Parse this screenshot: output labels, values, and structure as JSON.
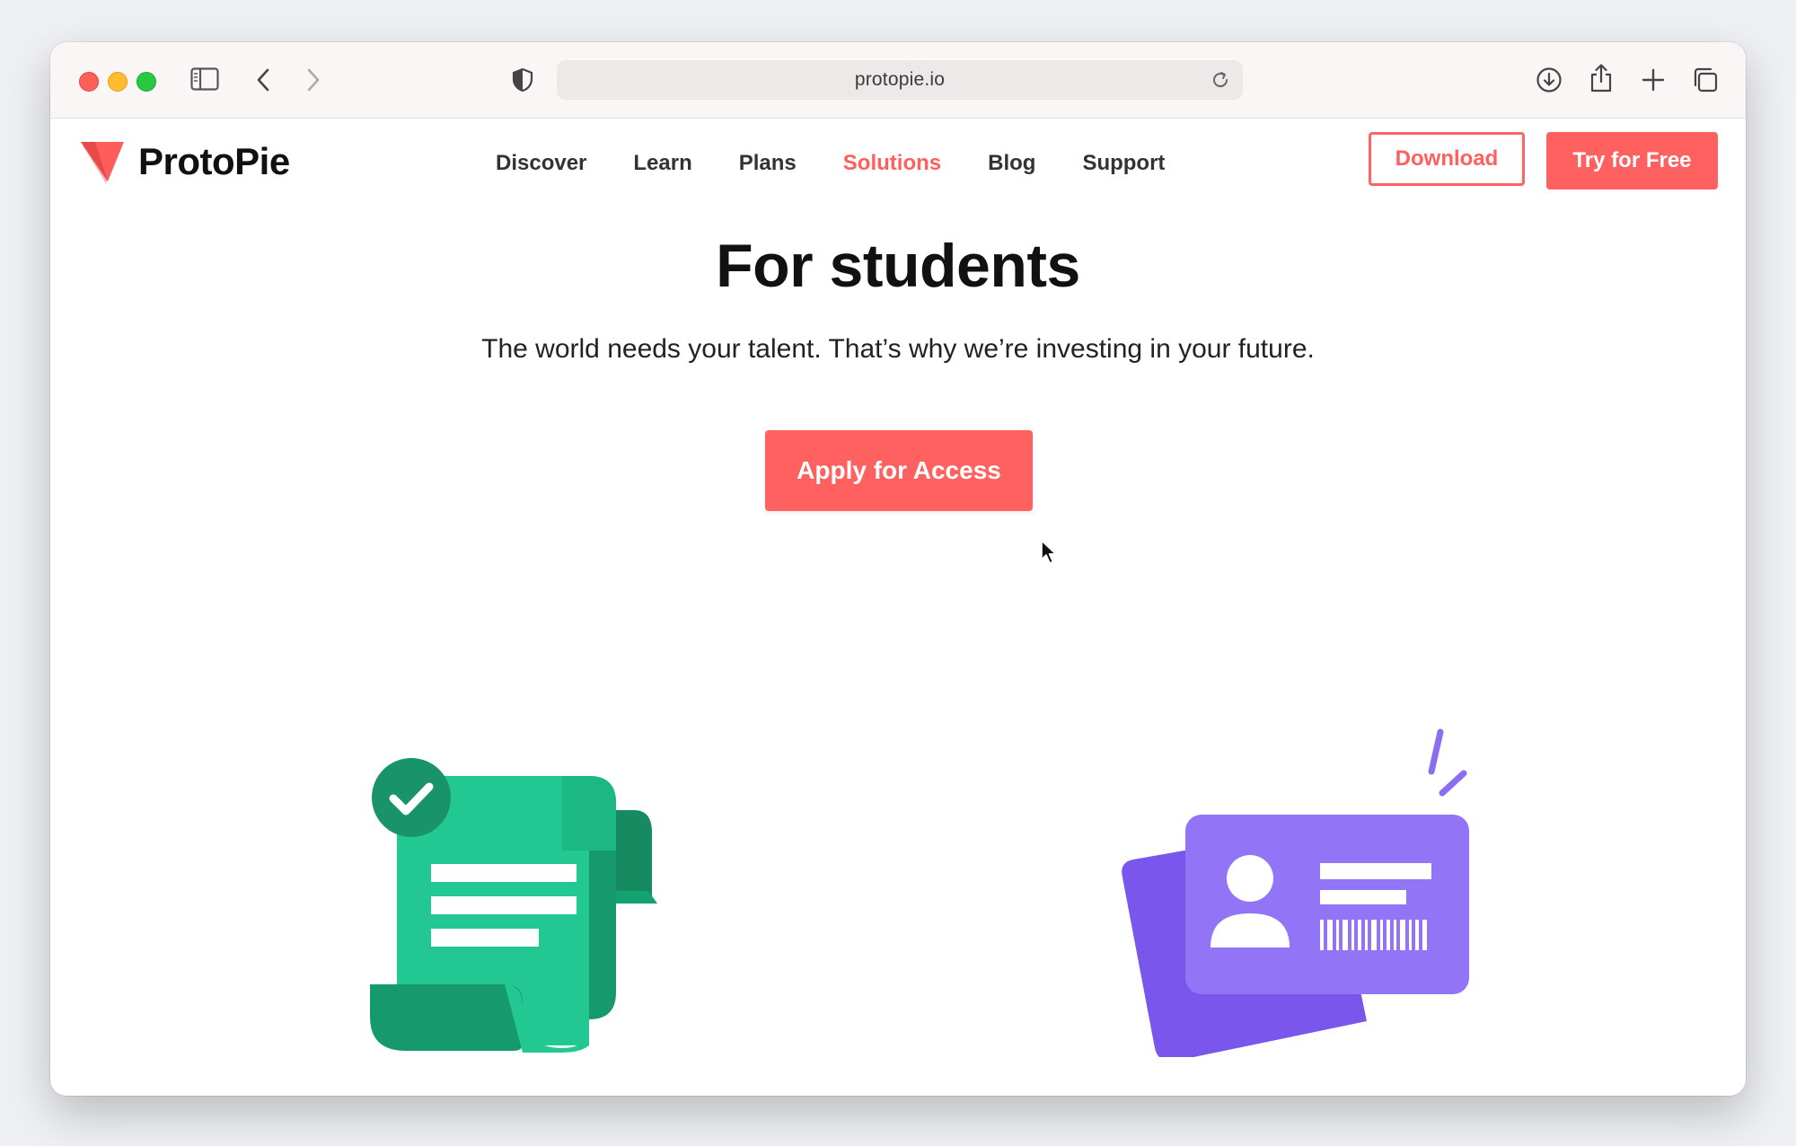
{
  "browser": {
    "url": "protopie.io",
    "icons": [
      "sidebar-icon",
      "back-icon",
      "forward-icon",
      "shield-icon",
      "reload-icon",
      "download-icon",
      "share-icon",
      "new-tab-icon",
      "tabs-icon"
    ]
  },
  "site": {
    "logo_text": "ProtoPie",
    "nav": [
      {
        "label": "Discover",
        "active": false
      },
      {
        "label": "Learn",
        "active": false
      },
      {
        "label": "Plans",
        "active": false
      },
      {
        "label": "Solutions",
        "active": true
      },
      {
        "label": "Blog",
        "active": false
      },
      {
        "label": "Support",
        "active": false
      }
    ],
    "download_label": "Download",
    "try_label": "Try for Free"
  },
  "hero": {
    "title": "For students",
    "subtitle": "The world needs your talent. That’s why we’re investing in your future.",
    "cta_label": "Apply for Access"
  },
  "colors": {
    "brand": "#ff6161",
    "doc_green": "#22c792",
    "doc_dark_green": "#169a6d",
    "id_purple": "#9274f7",
    "id_dark_purple": "#7a56ec"
  }
}
